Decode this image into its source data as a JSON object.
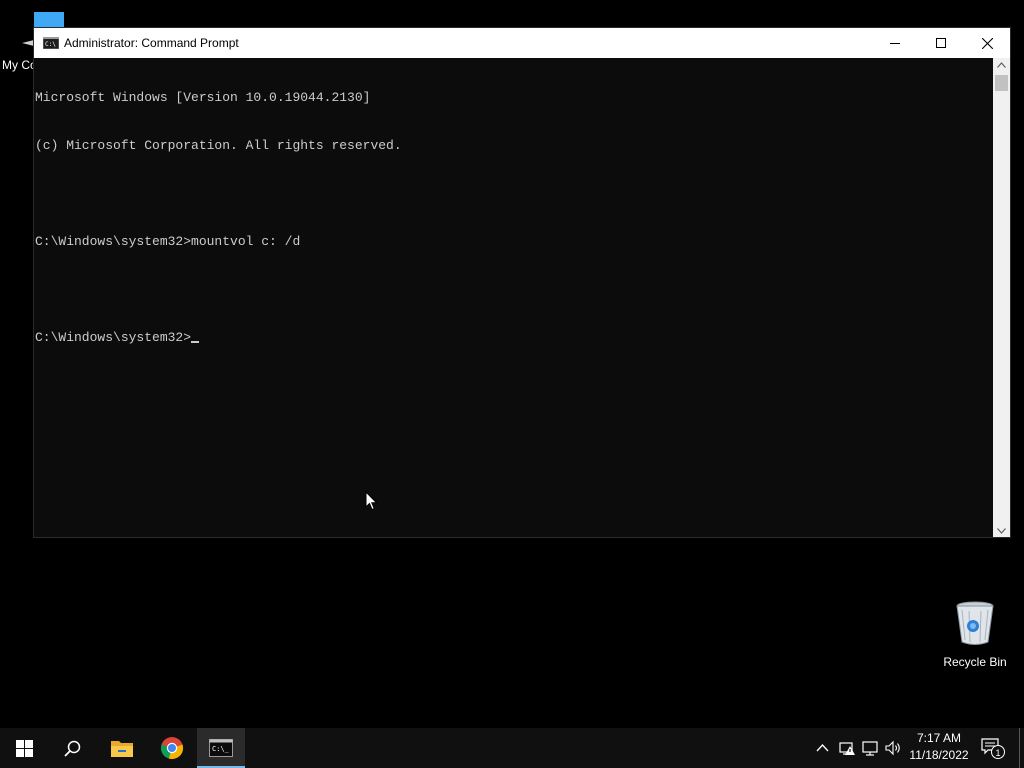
{
  "desktop": {
    "icons": [
      {
        "label": "My Computer",
        "visible_label": "My Co"
      },
      {
        "label": "Recycle Bin"
      }
    ]
  },
  "window": {
    "title": "Administrator: Command Prompt",
    "icon": "cmd-icon",
    "controls": {
      "minimize": "minimize-icon",
      "maximize": "maximize-icon",
      "close": "close-icon"
    }
  },
  "console": {
    "lines": [
      "Microsoft Windows [Version 10.0.19044.2130]",
      "(c) Microsoft Corporation. All rights reserved.",
      "",
      "C:\\Windows\\system32>mountvol c: /d",
      "",
      "C:\\Windows\\system32>"
    ],
    "text_color": "#cccccc",
    "background": "#0c0c0c"
  },
  "taskbar": {
    "items": [
      "start-icon",
      "search-icon",
      "file-explorer-icon",
      "chrome-icon",
      "command-prompt-icon"
    ],
    "active_item": "command-prompt-icon",
    "accent": "#76b9ed",
    "tray": {
      "icons": [
        "chevron-up-icon",
        "network-warning-icon",
        "network-icon",
        "volume-icon"
      ],
      "time": "7:17 AM",
      "date": "11/18/2022",
      "notification_count": "1"
    }
  }
}
